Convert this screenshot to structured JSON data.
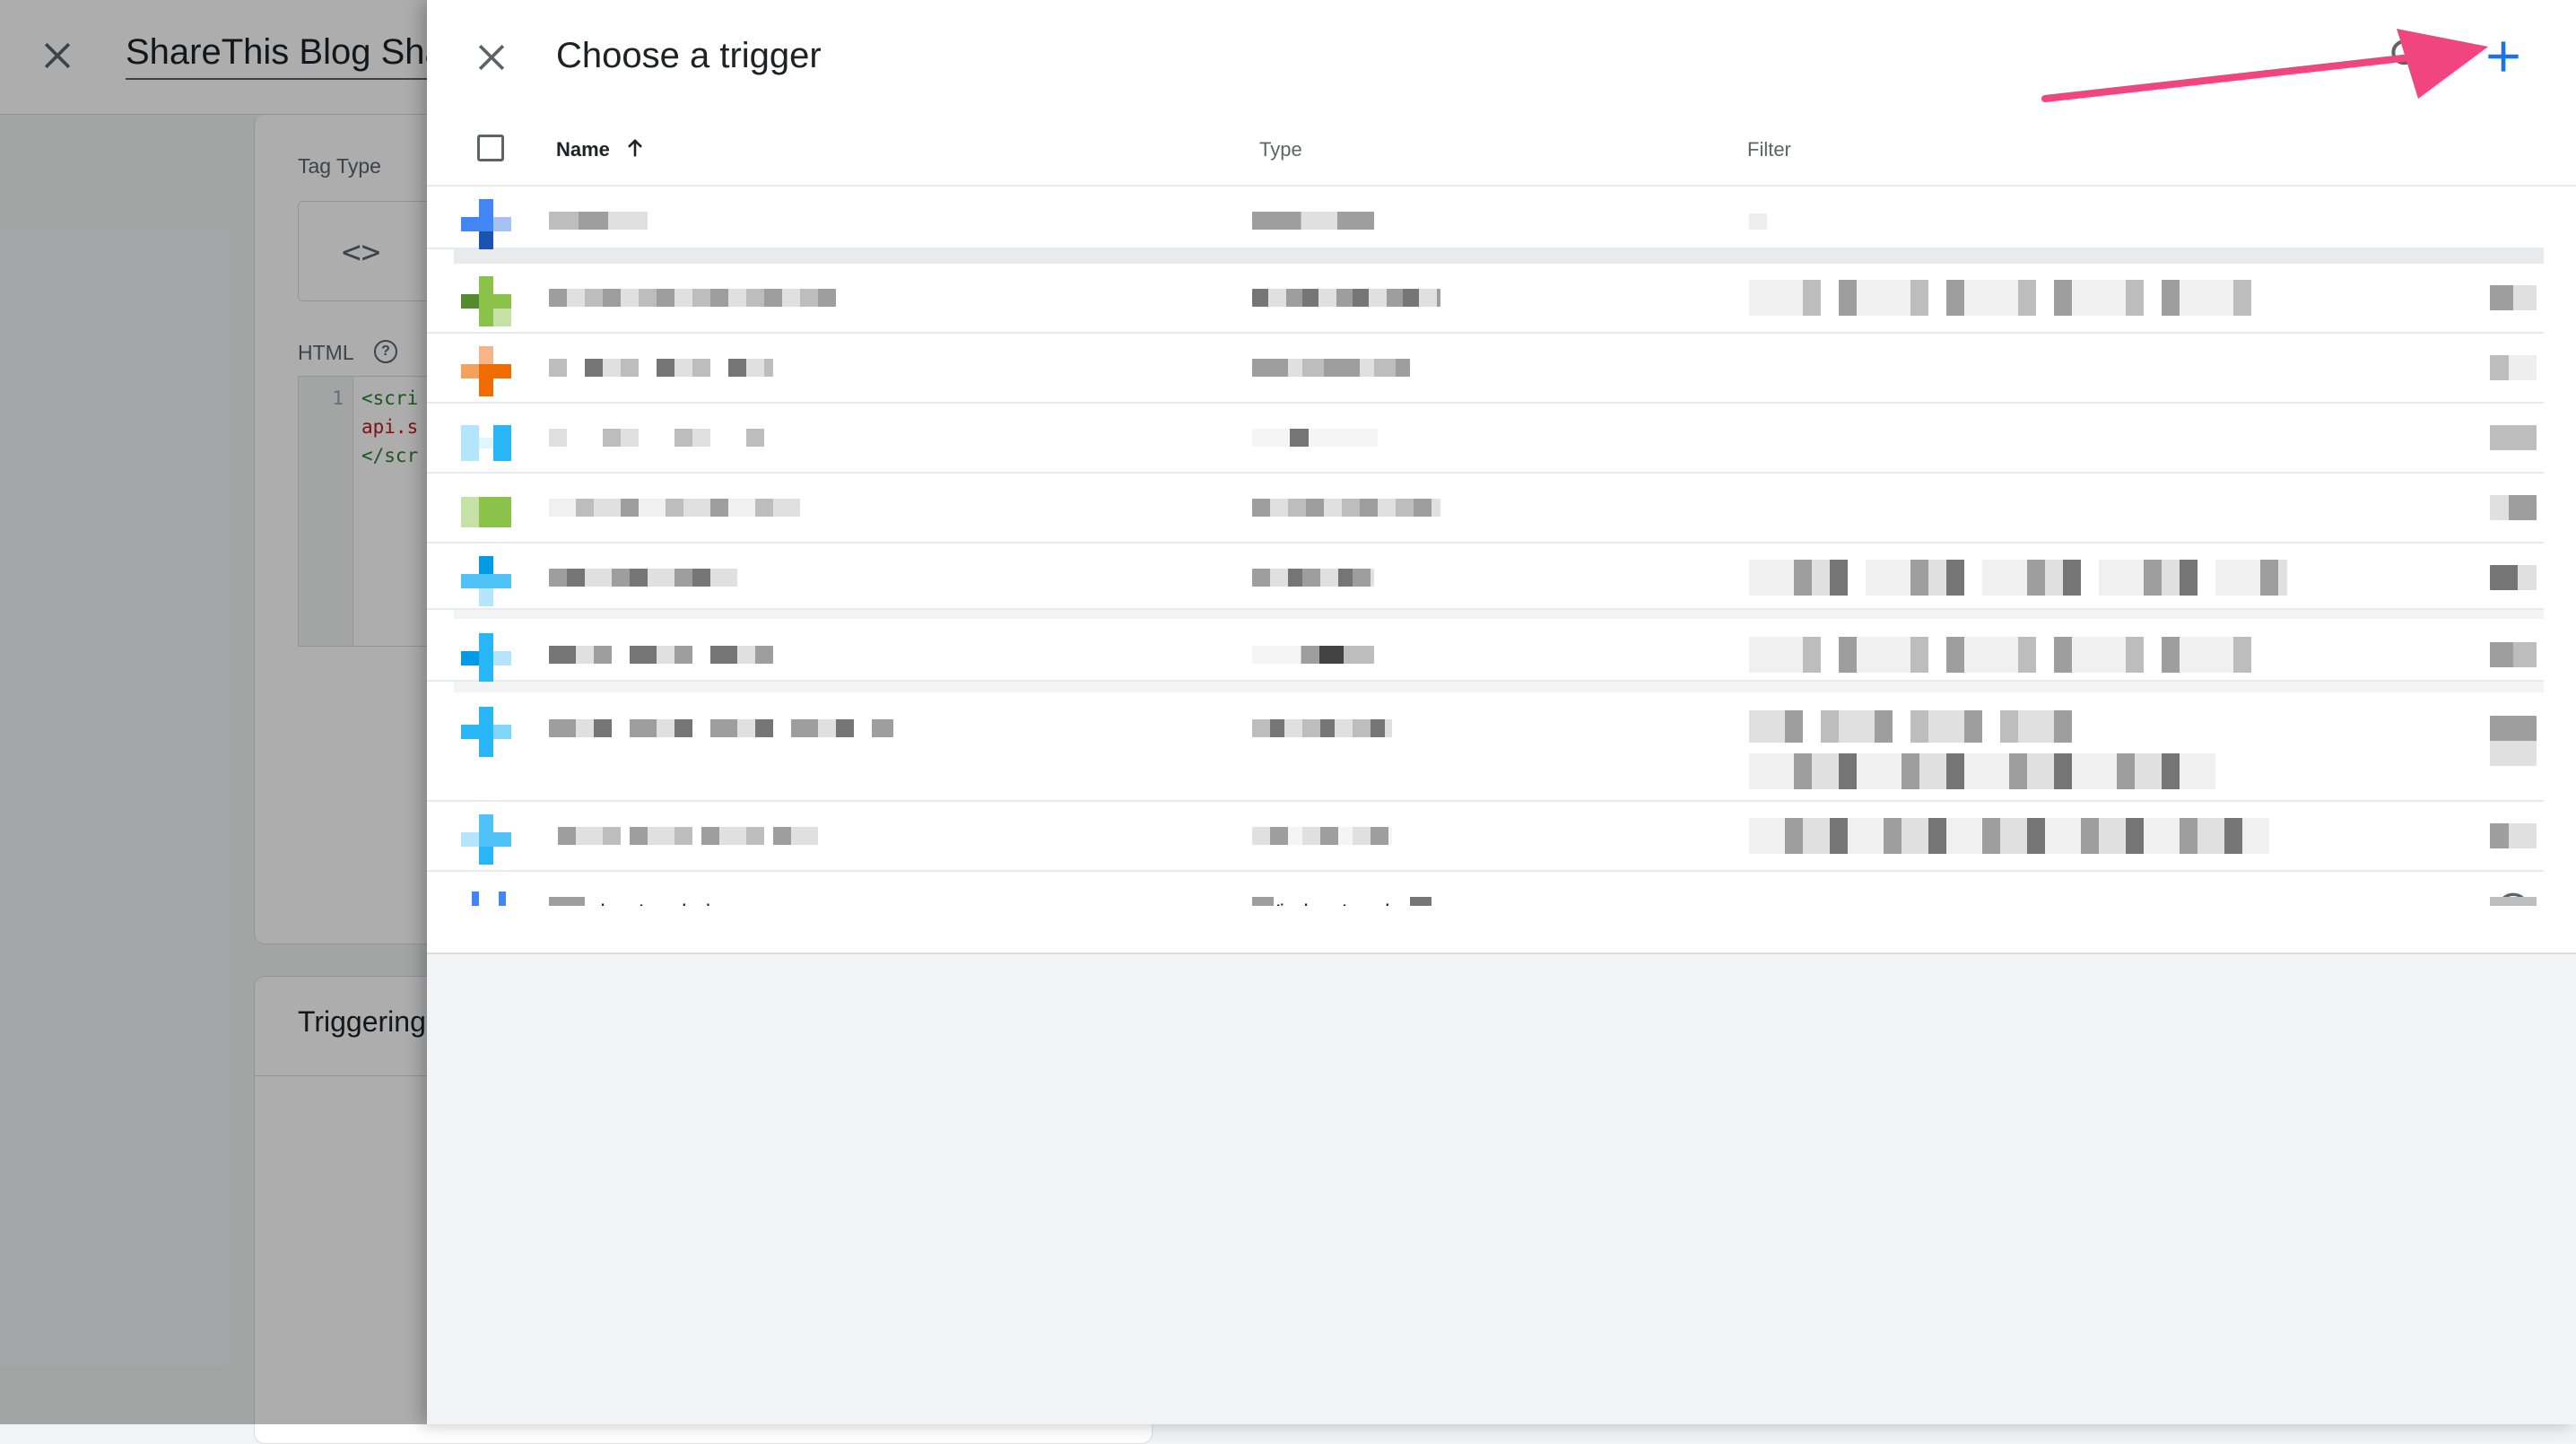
{
  "background_editor": {
    "tag_title": "ShareThis Blog Sha",
    "tag_type_label": "Tag Type",
    "tag_type_icon": "<>",
    "html_label": "HTML",
    "code_line_number": "1",
    "code_lines": [
      "<scri",
      "api.s",
      "</scr"
    ],
    "triggering_title": "Triggering"
  },
  "panel": {
    "title": "Choose a trigger",
    "columns": {
      "name": "Name",
      "type": "Type",
      "filter": "Filter"
    },
    "icons": {
      "close": "close-icon",
      "search": "search-icon",
      "add": "plus-icon",
      "sort": "arrow-up-icon",
      "info": "info-icon"
    },
    "accent_color": "#1a73e8",
    "arrow_color": "#f0457e",
    "rows": [
      {
        "icon_color": "#4285f4"
      },
      {
        "icon_color": "#8bc34a"
      },
      {
        "icon_color": "#ef6c00"
      },
      {
        "icon_color": "#4fc3f7"
      },
      {
        "icon_color": "#8bc34a"
      },
      {
        "icon_color": "#4fc3f7"
      },
      {
        "icon_color": "#29b6f6"
      },
      {
        "icon_color": "#29b6f6"
      },
      {
        "icon_color": "#4fc3f7"
      }
    ],
    "last_row": {
      "name": "Window Loaded",
      "type": "Window Loaded",
      "icon_color": "#4285f4"
    }
  }
}
